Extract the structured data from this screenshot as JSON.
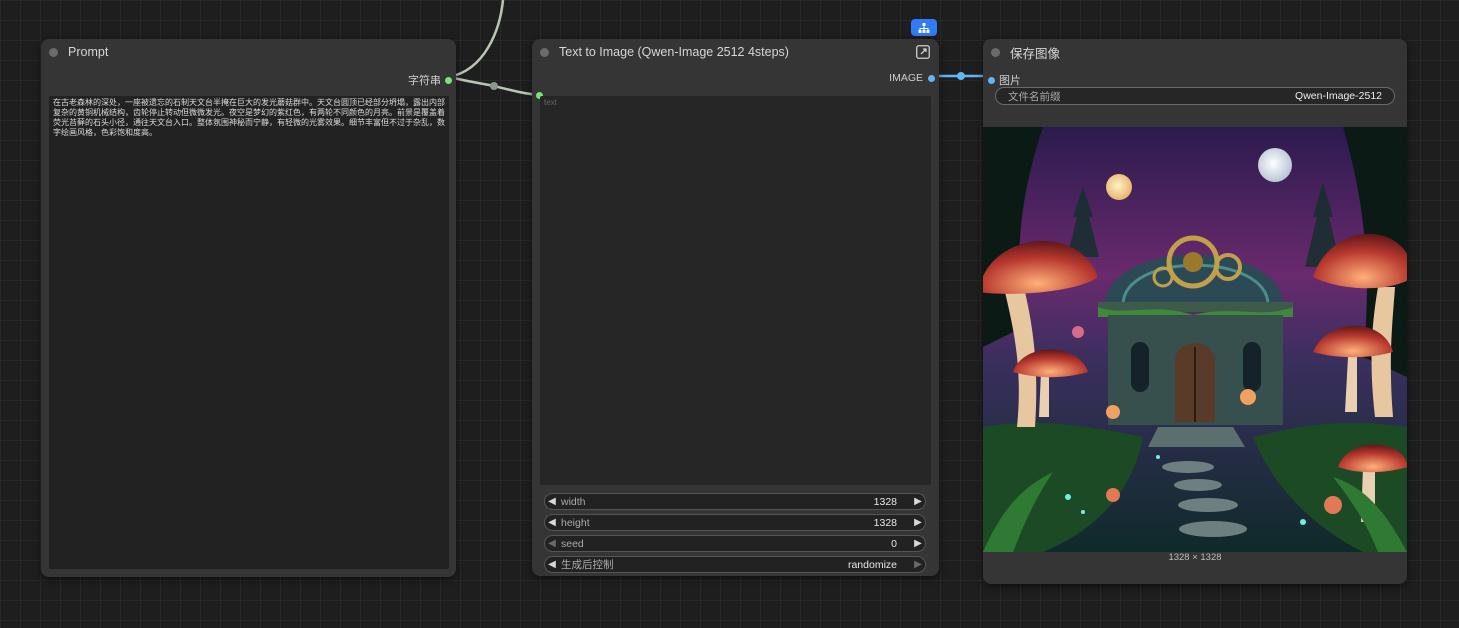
{
  "prompt_node": {
    "title": "Prompt",
    "output_label": "字符串",
    "text": "在古老森林的深处，一座被遗忘的石制天文台半掩在巨大的发光蘑菇群中。天文台圆顶已经部分坍塌，露出内部复杂的黄铜机械结构，齿轮停止转动但微微发光。夜空是梦幻的紫红色，有两轮不同颜色的月亮。前景是覆盖着荧光苔藓的石头小径，通往天文台入口。整体氛围神秘而宁静，有轻微的光雾效果。细节丰富但不过于杂乱，数字绘画风格，色彩饱和度高。"
  },
  "t2i_node": {
    "title": "Text to Image (Qwen-Image 2512 4steps)",
    "output_label": "IMAGE",
    "text_placeholder": "text",
    "widgets": [
      {
        "label": "width",
        "value": "1328"
      },
      {
        "label": "height",
        "value": "1328"
      },
      {
        "label": "seed",
        "value": "0"
      },
      {
        "label": "生成后控制",
        "value": "randomize"
      }
    ]
  },
  "save_node": {
    "title": "保存图像",
    "input_label": "图片",
    "filename_prefix_label": "文件名前缀",
    "filename_prefix_value": "Qwen-Image-2512",
    "image_size_text": "1328 × 1328"
  },
  "colors": {
    "string_slot": "#7ce27c",
    "image_slot": "#64b5f6",
    "badge": "#2f7cf6"
  },
  "icons": [
    "node-link-icon",
    "expand-icon",
    "decrement-arrow-icon",
    "increment-arrow-icon"
  ]
}
